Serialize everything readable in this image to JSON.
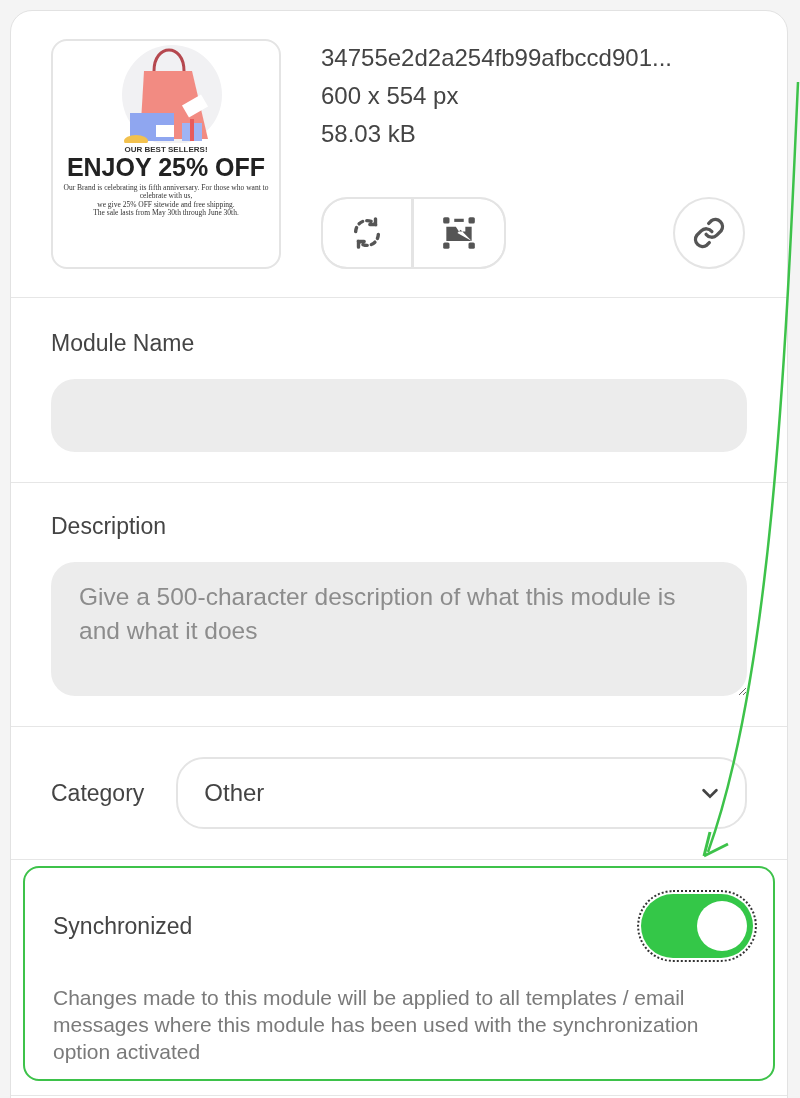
{
  "thumbnail": {
    "kicker": "OUR BEST SELLERS!",
    "headline": "ENJOY 25% OFF",
    "body_lines": [
      "Our Brand is celebrating its fifth anniversary. For those who want to celebrate with us,",
      "we give 25% OFF sitewide and free shipping.",
      "The sale lasts from May 30th through June 30th."
    ]
  },
  "file": {
    "name": "34755e2d2a254fb99afbccd901...",
    "dimensions": "600 x 554 px",
    "size": "58.03 kB"
  },
  "module_name": {
    "label": "Module Name"
  },
  "description": {
    "label": "Description",
    "placeholder": "Give a 500-character description of what this module is and what it does"
  },
  "category": {
    "label": "Category",
    "value": "Other"
  },
  "synchronized": {
    "label": "Synchronized",
    "on": true,
    "help": "Changes made to this module will be applied to all templates / email messages where this module has been used with the synchronization option activated",
    "highlighted": true
  }
}
